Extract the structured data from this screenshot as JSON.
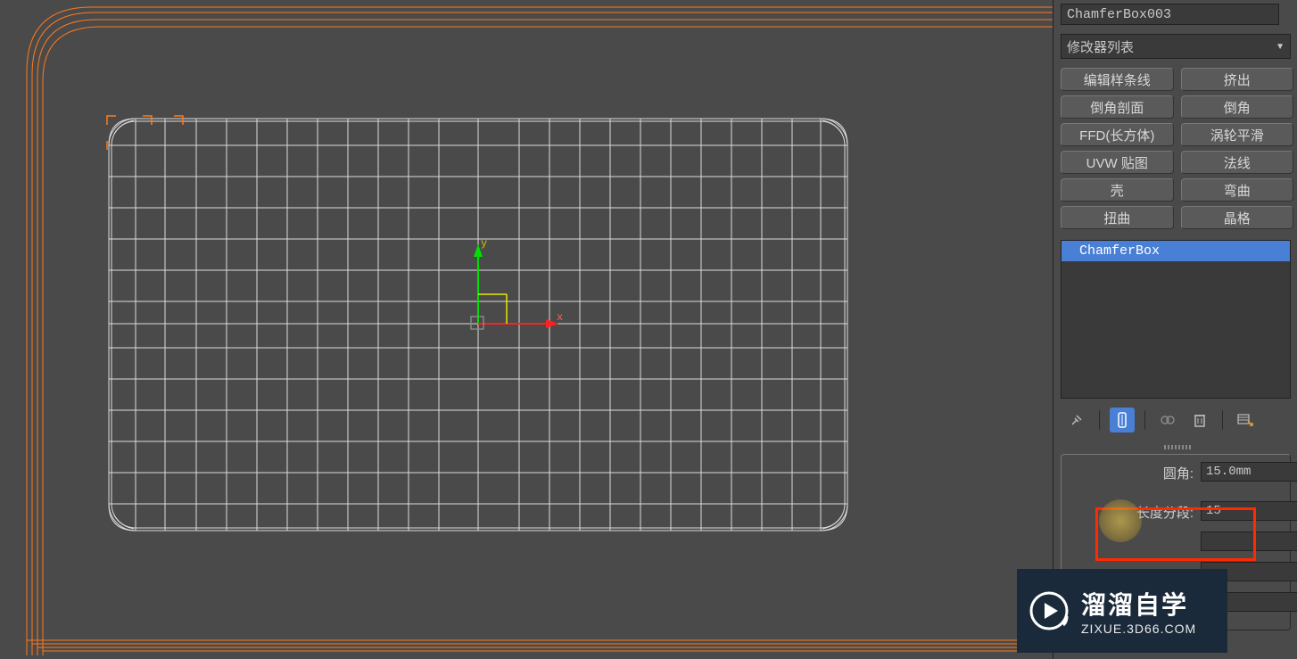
{
  "object_name": "ChamferBox003",
  "modifier_dropdown": "修改器列表",
  "modifier_buttons": [
    [
      "编辑样条线",
      "挤出"
    ],
    [
      "倒角剖面",
      "倒角"
    ],
    [
      "FFD(长方体)",
      "涡轮平滑"
    ],
    [
      "UVW 贴图",
      "法线"
    ],
    [
      "壳",
      "弯曲"
    ],
    [
      "扭曲",
      "晶格"
    ]
  ],
  "stack_item": "ChamferBox",
  "params": {
    "fillet_label": "圆角:",
    "fillet_value": "15.0mm",
    "length_segs_label": "长度分段:",
    "length_segs_value": "15"
  },
  "gizmo": {
    "x_label": "x",
    "y_label": "y"
  },
  "watermark": {
    "title": "溜溜自学",
    "url": "ZIXUE.3D66.COM"
  }
}
